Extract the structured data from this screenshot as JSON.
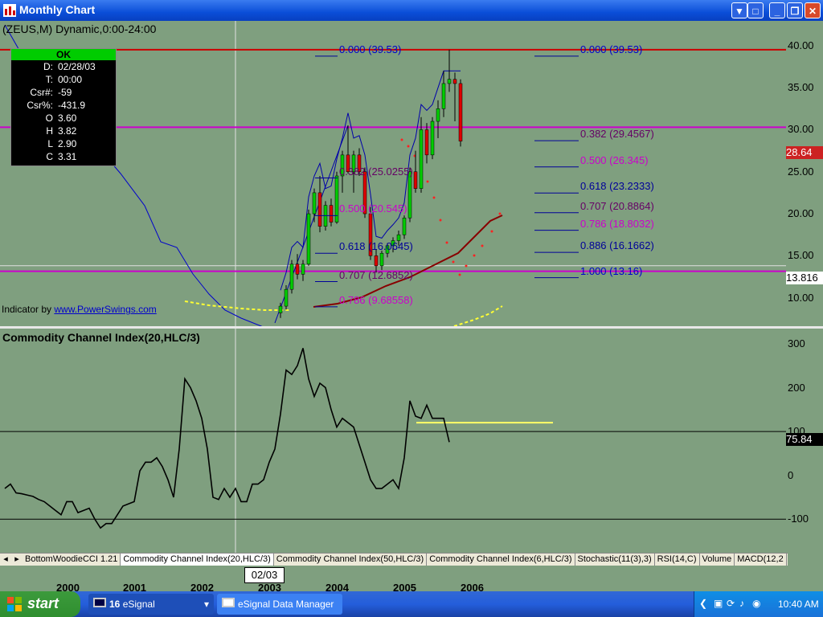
{
  "window": {
    "title": "Monthly Chart"
  },
  "price_pane": {
    "label": "(ZEUS,M) Dynamic,0:00-24:00",
    "scale_ticks": [
      "40.00",
      "35.00",
      "30.00",
      "25.00",
      "20.00",
      "15.00",
      "10.00"
    ],
    "last_price": "28.64",
    "crosshair_price": "13.816",
    "indicator_credit_prefix": "Indicator by ",
    "indicator_credit_link": "www.PowerSwings.com",
    "fib_right": [
      {
        "text": "0.000 (39.53)",
        "color": "#0000cc"
      },
      {
        "text": "0.382 (29.4567)",
        "color": "#660066"
      },
      {
        "text": "0.500 (26.345)",
        "color": "#cc00cc"
      },
      {
        "text": "0.618 (23.2333)",
        "color": "#000099"
      },
      {
        "text": "0.707 (20.8864)",
        "color": "#660066"
      },
      {
        "text": "0.786 (18.8032)",
        "color": "#cc00cc"
      },
      {
        "text": "0.886 (16.1662)",
        "color": "#000099"
      },
      {
        "text": "1.000 (13.16)",
        "color": "#0000cc"
      }
    ],
    "fib_left": [
      {
        "text": "0.000 (39.53)",
        "color": "#0000cc"
      },
      {
        "text": "0.382 (25.0255)",
        "color": "#660066"
      },
      {
        "text": "0.500 (20.545)",
        "color": "#cc00cc"
      },
      {
        "text": "0.618 (16.0645)",
        "color": "#000099"
      },
      {
        "text": "0.707 (12.6852)",
        "color": "#660066"
      },
      {
        "text": "0.786 (9.68558)",
        "color": "#cc00cc"
      }
    ]
  },
  "cursor_info": {
    "status": "OK",
    "rows": [
      {
        "k": "D:",
        "v": "02/28/03"
      },
      {
        "k": "T:",
        "v": "00:00"
      },
      {
        "k": "Csr#:",
        "v": "-59"
      },
      {
        "k": "Csr%:",
        "v": "-431.9"
      },
      {
        "k": "O",
        "v": "3.60"
      },
      {
        "k": "H",
        "v": "3.82"
      },
      {
        "k": "L",
        "v": "2.90"
      },
      {
        "k": "C",
        "v": "3.31"
      }
    ]
  },
  "cci_pane": {
    "label": "Commodity Channel Index(20,HLC/3)",
    "scale_ticks": [
      "300",
      "200",
      "100",
      "0",
      "-100"
    ],
    "last_value": "75.84"
  },
  "chart_data": [
    {
      "type": "candlestick",
      "title": "(ZEUS,M) Dynamic,0:00-24:00",
      "ylim": [
        7,
        42
      ],
      "x_range": [
        "1999-09",
        "2007-05"
      ],
      "horizontal_lines": [
        39.53,
        30.3,
        13.16
      ],
      "candles": [
        {
          "d": "2003-10",
          "o": 8.2,
          "h": 9.4,
          "l": 7.6,
          "c": 9.0
        },
        {
          "d": "2003-11",
          "o": 9.0,
          "h": 11.5,
          "l": 8.6,
          "c": 11.0
        },
        {
          "d": "2003-12",
          "o": 11.0,
          "h": 14.5,
          "l": 10.5,
          "c": 14.0
        },
        {
          "d": "2004-01",
          "o": 14.0,
          "h": 15.2,
          "l": 12.2,
          "c": 12.8
        },
        {
          "d": "2004-02",
          "o": 12.8,
          "h": 14.5,
          "l": 12.0,
          "c": 14.0
        },
        {
          "d": "2004-03",
          "o": 14.0,
          "h": 20.5,
          "l": 13.8,
          "c": 20.0
        },
        {
          "d": "2004-04",
          "o": 20.0,
          "h": 23.0,
          "l": 19.0,
          "c": 22.5
        },
        {
          "d": "2004-05",
          "o": 22.5,
          "h": 24.5,
          "l": 17.8,
          "c": 18.5
        },
        {
          "d": "2004-06",
          "o": 18.5,
          "h": 21.5,
          "l": 18.0,
          "c": 21.0
        },
        {
          "d": "2004-07",
          "o": 21.0,
          "h": 21.8,
          "l": 18.5,
          "c": 19.0
        },
        {
          "d": "2004-08",
          "o": 19.0,
          "h": 25.0,
          "l": 18.8,
          "c": 24.5
        },
        {
          "d": "2004-09",
          "o": 24.5,
          "h": 27.5,
          "l": 22.5,
          "c": 27.0
        },
        {
          "d": "2004-10",
          "o": 27.0,
          "h": 30.5,
          "l": 24.8,
          "c": 25.0
        },
        {
          "d": "2004-11",
          "o": 25.0,
          "h": 27.5,
          "l": 22.5,
          "c": 27.0
        },
        {
          "d": "2004-12",
          "o": 27.0,
          "h": 27.8,
          "l": 24.5,
          "c": 25.0
        },
        {
          "d": "2005-01",
          "o": 25.0,
          "h": 25.5,
          "l": 19.5,
          "c": 20.0
        },
        {
          "d": "2005-02",
          "o": 20.0,
          "h": 20.8,
          "l": 14.5,
          "c": 15.0
        },
        {
          "d": "2005-03",
          "o": 15.0,
          "h": 15.8,
          "l": 13.0,
          "c": 13.8
        },
        {
          "d": "2005-04",
          "o": 13.8,
          "h": 15.6,
          "l": 13.3,
          "c": 15.3
        },
        {
          "d": "2005-05",
          "o": 15.3,
          "h": 16.5,
          "l": 14.8,
          "c": 16.2
        },
        {
          "d": "2005-06",
          "o": 16.2,
          "h": 17.2,
          "l": 15.4,
          "c": 16.8
        },
        {
          "d": "2005-07",
          "o": 16.8,
          "h": 18.0,
          "l": 16.2,
          "c": 17.5
        },
        {
          "d": "2005-08",
          "o": 17.5,
          "h": 19.8,
          "l": 17.0,
          "c": 19.5
        },
        {
          "d": "2005-09",
          "o": 19.5,
          "h": 25.5,
          "l": 19.0,
          "c": 25.0
        },
        {
          "d": "2005-10",
          "o": 25.0,
          "h": 27.5,
          "l": 22.5,
          "c": 23.0
        },
        {
          "d": "2005-11",
          "o": 23.0,
          "h": 31.5,
          "l": 22.5,
          "c": 30.0
        },
        {
          "d": "2005-12",
          "o": 30.0,
          "h": 30.8,
          "l": 26.0,
          "c": 27.0
        },
        {
          "d": "2006-01",
          "o": 27.0,
          "h": 31.5,
          "l": 26.5,
          "c": 31.0
        },
        {
          "d": "2006-02",
          "o": 31.0,
          "h": 33.5,
          "l": 29.0,
          "c": 32.5
        },
        {
          "d": "2006-03",
          "o": 32.5,
          "h": 37.0,
          "l": 31.5,
          "c": 35.5
        },
        {
          "d": "2006-04",
          "o": 35.5,
          "h": 39.53,
          "l": 34.5,
          "c": 36.0
        },
        {
          "d": "2006-05",
          "o": 36.0,
          "h": 36.8,
          "l": 31.0,
          "c": 35.5
        },
        {
          "d": "2006-06",
          "o": 35.5,
          "h": 36.0,
          "l": 28.0,
          "c": 28.64
        }
      ]
    },
    {
      "type": "line",
      "title": "Commodity Channel Index(20,HLC/3)",
      "ylim": [
        -160,
        320
      ],
      "reference_lines": [
        100,
        -100
      ],
      "series": [
        {
          "name": "Commodity Channel Index(20,HLC/3)",
          "x_start": "1999-09",
          "values": [
            -30,
            -20,
            -40,
            -42,
            -45,
            -48,
            -55,
            -60,
            -70,
            -80,
            -90,
            -60,
            -60,
            -85,
            -80,
            -75,
            -100,
            -120,
            -110,
            -110,
            -90,
            -70,
            -65,
            -60,
            10,
            30,
            30,
            40,
            20,
            -10,
            -50,
            60,
            220,
            200,
            170,
            130,
            60,
            -50,
            -55,
            -30,
            -50,
            -30,
            -60,
            -60,
            -20,
            -20,
            -10,
            30,
            60,
            140,
            240,
            230,
            250,
            290,
            220,
            180,
            210,
            200,
            150,
            110,
            130,
            120,
            110,
            70,
            30,
            -10,
            -30,
            -30,
            -20,
            -10,
            -30,
            40,
            170,
            135,
            130,
            160,
            130,
            130,
            130,
            75.84
          ]
        }
      ]
    }
  ],
  "tabs": [
    "BottomWoodieCCI 1.21",
    "Commodity Channel Index(20,HLC/3)",
    "Commodity Channel Index(50,HLC/3)",
    "Commodity Channel Index(6,HLC/3)",
    "Stochastic(11(3),3)",
    "RSI(14,C)",
    "Volume",
    "MACD(12,2"
  ],
  "x_axis": {
    "years": [
      "2000",
      "2001",
      "2002",
      "2003",
      "2004",
      "2005",
      "2006"
    ],
    "cursor_date": "02/03"
  },
  "taskbar": {
    "start_label": "start",
    "task1_count": "16",
    "task1_label": "eSignal",
    "task2_label": "eSignal Data Manager",
    "clock": "10:40 AM"
  },
  "colors": {
    "background": "#7f9f7f",
    "red_line": "#cc0000",
    "magenta_line": "#cc00cc",
    "blue_line": "#0000cc",
    "candle_up": "#00cc00",
    "candle_down": "#dd0000"
  }
}
